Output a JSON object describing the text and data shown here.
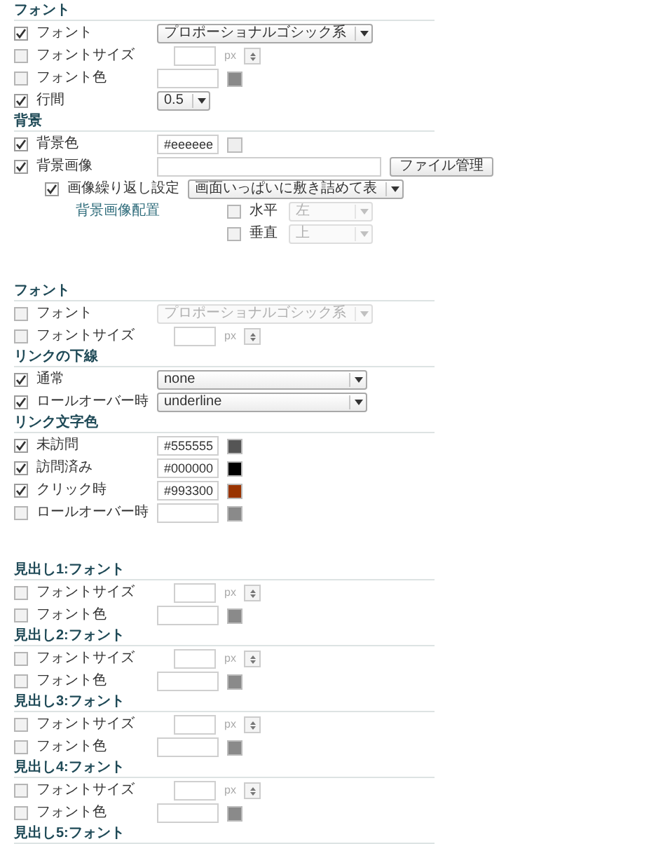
{
  "groups": [
    {
      "sections": [
        {
          "heading": "フォント",
          "rows": [
            {
              "kind": "select",
              "checked": true,
              "label": "フォント",
              "select": {
                "value": "プロポーショナルゴシック系",
                "disabled": false
              }
            },
            {
              "kind": "size",
              "checked": false,
              "label": "フォントサイズ",
              "unit": "px"
            },
            {
              "kind": "color",
              "checked": false,
              "label": "フォント色",
              "color": "#8a8a8a"
            },
            {
              "kind": "select",
              "checked": true,
              "label": "行間",
              "select": {
                "value": "0.5",
                "disabled": false
              }
            }
          ]
        },
        {
          "heading": "背景",
          "rows": [
            {
              "kind": "color",
              "checked": true,
              "label": "背景色",
              "value": "#eeeeee",
              "color": "#eeeeee"
            },
            {
              "kind": "file",
              "checked": true,
              "label": "背景画像",
              "button": "ファイル管理"
            },
            {
              "kind": "repeat",
              "checked": true,
              "label": "画像繰り返し設定",
              "select": {
                "value": "画面いっぱいに敷き詰めて表",
                "disabled": false
              }
            },
            {
              "kind": "position",
              "label": "背景画像配置",
              "options": [
                {
                  "checked": false,
                  "label": "水平",
                  "select": {
                    "value": "左",
                    "disabled": true
                  }
                },
                {
                  "checked": false,
                  "label": "垂直",
                  "select": {
                    "value": "上",
                    "disabled": true
                  }
                }
              ]
            }
          ]
        }
      ]
    },
    {
      "sections": [
        {
          "heading": "フォント",
          "rows": [
            {
              "kind": "select",
              "checked": false,
              "label": "フォント",
              "select": {
                "value": "プロポーショナルゴシック系",
                "disabled": true
              }
            },
            {
              "kind": "size",
              "checked": false,
              "label": "フォントサイズ",
              "unit": "px"
            }
          ]
        },
        {
          "heading": "リンクの下線",
          "rows": [
            {
              "kind": "wide-select",
              "checked": true,
              "label": "通常",
              "select": {
                "value": "none",
                "disabled": false
              }
            },
            {
              "kind": "wide-select",
              "checked": true,
              "label": "ロールオーバー時",
              "select": {
                "value": "underline",
                "disabled": false
              }
            }
          ]
        },
        {
          "heading": "リンク文字色",
          "rows": [
            {
              "kind": "color",
              "checked": true,
              "label": "未訪問",
              "value": "#555555",
              "color": "#555555"
            },
            {
              "kind": "color",
              "checked": true,
              "label": "訪問済み",
              "value": "#000000",
              "color": "#000000"
            },
            {
              "kind": "color",
              "checked": true,
              "label": "クリック時",
              "value": "#993300",
              "color": "#993300"
            },
            {
              "kind": "color",
              "checked": false,
              "label": "ロールオーバー時",
              "color": "#8a8a8a"
            }
          ]
        }
      ]
    },
    {
      "sections": [
        {
          "heading": "見出し1:フォント",
          "rows": [
            {
              "kind": "size",
              "checked": false,
              "label": "フォントサイズ",
              "unit": "px"
            },
            {
              "kind": "color",
              "checked": false,
              "label": "フォント色",
              "color": "#8a8a8a"
            }
          ]
        },
        {
          "heading": "見出し2:フォント",
          "rows": [
            {
              "kind": "size",
              "checked": false,
              "label": "フォントサイズ",
              "unit": "px"
            },
            {
              "kind": "color",
              "checked": false,
              "label": "フォント色",
              "color": "#8a8a8a"
            }
          ]
        },
        {
          "heading": "見出し3:フォント",
          "rows": [
            {
              "kind": "size",
              "checked": false,
              "label": "フォントサイズ",
              "unit": "px"
            },
            {
              "kind": "color",
              "checked": false,
              "label": "フォント色",
              "color": "#8a8a8a"
            }
          ]
        },
        {
          "heading": "見出し4:フォント",
          "rows": [
            {
              "kind": "size",
              "checked": false,
              "label": "フォントサイズ",
              "unit": "px"
            },
            {
              "kind": "color",
              "checked": false,
              "label": "フォント色",
              "color": "#8a8a8a"
            }
          ]
        },
        {
          "heading": "見出し5:フォント"
        }
      ]
    }
  ]
}
